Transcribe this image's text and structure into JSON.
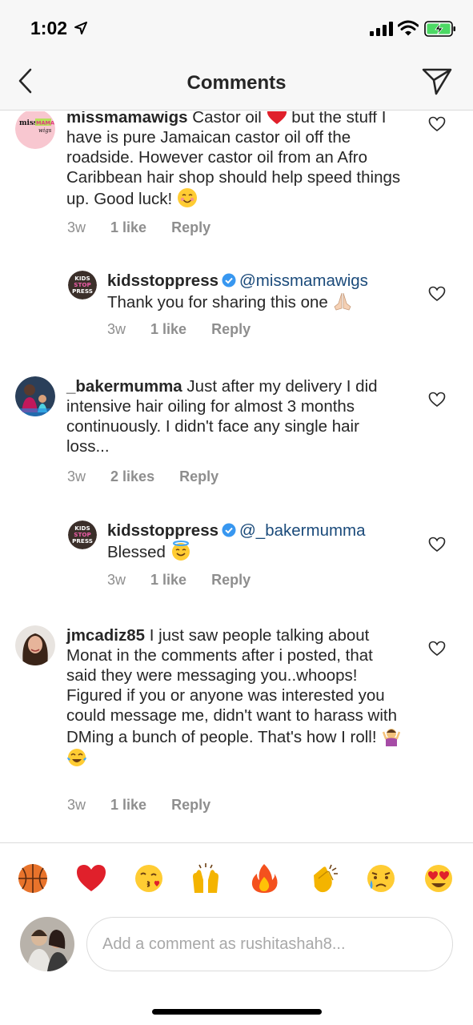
{
  "status_bar": {
    "time": "1:02"
  },
  "nav": {
    "title": "Comments"
  },
  "comments": [
    {
      "username": "missmamawigs",
      "text_a": "Castor oil",
      "text_b": "but the stuff I have is pure Jamaican castor oil off the roadside. However castor oil from an Afro Caribbean hair shop should help speed things up. Good luck!",
      "avatar_text_1": "miss",
      "avatar_text_2": "MAMA",
      "avatar_text_3": "wigs",
      "time": "3w",
      "likes": "1 like",
      "reply": "Reply"
    },
    {
      "username": "kidsstoppress",
      "mention": "@missmamawigs",
      "text": "Thank you for sharing this one",
      "avatar_text_1": "KIDS",
      "avatar_text_2": "STOP",
      "avatar_text_3": "PRESS",
      "time": "3w",
      "likes": "1 like",
      "reply": "Reply"
    },
    {
      "username": "_bakermumma",
      "text": "Just after my delivery I did intensive hair oiling for almost 3 months continuously. I didn't face any single hair loss...",
      "time": "3w",
      "likes": "2 likes",
      "reply": "Reply"
    },
    {
      "username": "kidsstoppress",
      "mention": "@_bakermumma",
      "text": "Blessed",
      "avatar_text_1": "KIDS",
      "avatar_text_2": "STOP",
      "avatar_text_3": "PRESS",
      "time": "3w",
      "likes": "1 like",
      "reply": "Reply"
    },
    {
      "username": "jmcadiz85",
      "text": "I just saw people talking about Monat in the comments after i posted, that said they were messaging you..whoops! Figured if you or anyone was interested you could message me, didn't want to harass with DMing a bunch of people. That's how I roll!",
      "time": "3w",
      "likes": "1 like",
      "reply": "Reply"
    }
  ],
  "quick_emojis": [
    "basketball-icon",
    "heart-icon",
    "kiss-face-icon",
    "raised-hands-icon",
    "fire-icon",
    "clapping-hands-icon",
    "crying-face-icon",
    "heart-eyes-icon"
  ],
  "composer": {
    "placeholder": "Add a comment as rushitashah8..."
  },
  "colors": {
    "accent": "#3897f0",
    "heart": "#ed4956",
    "mention": "#1a4a7a",
    "muted": "#8e8e8e"
  }
}
